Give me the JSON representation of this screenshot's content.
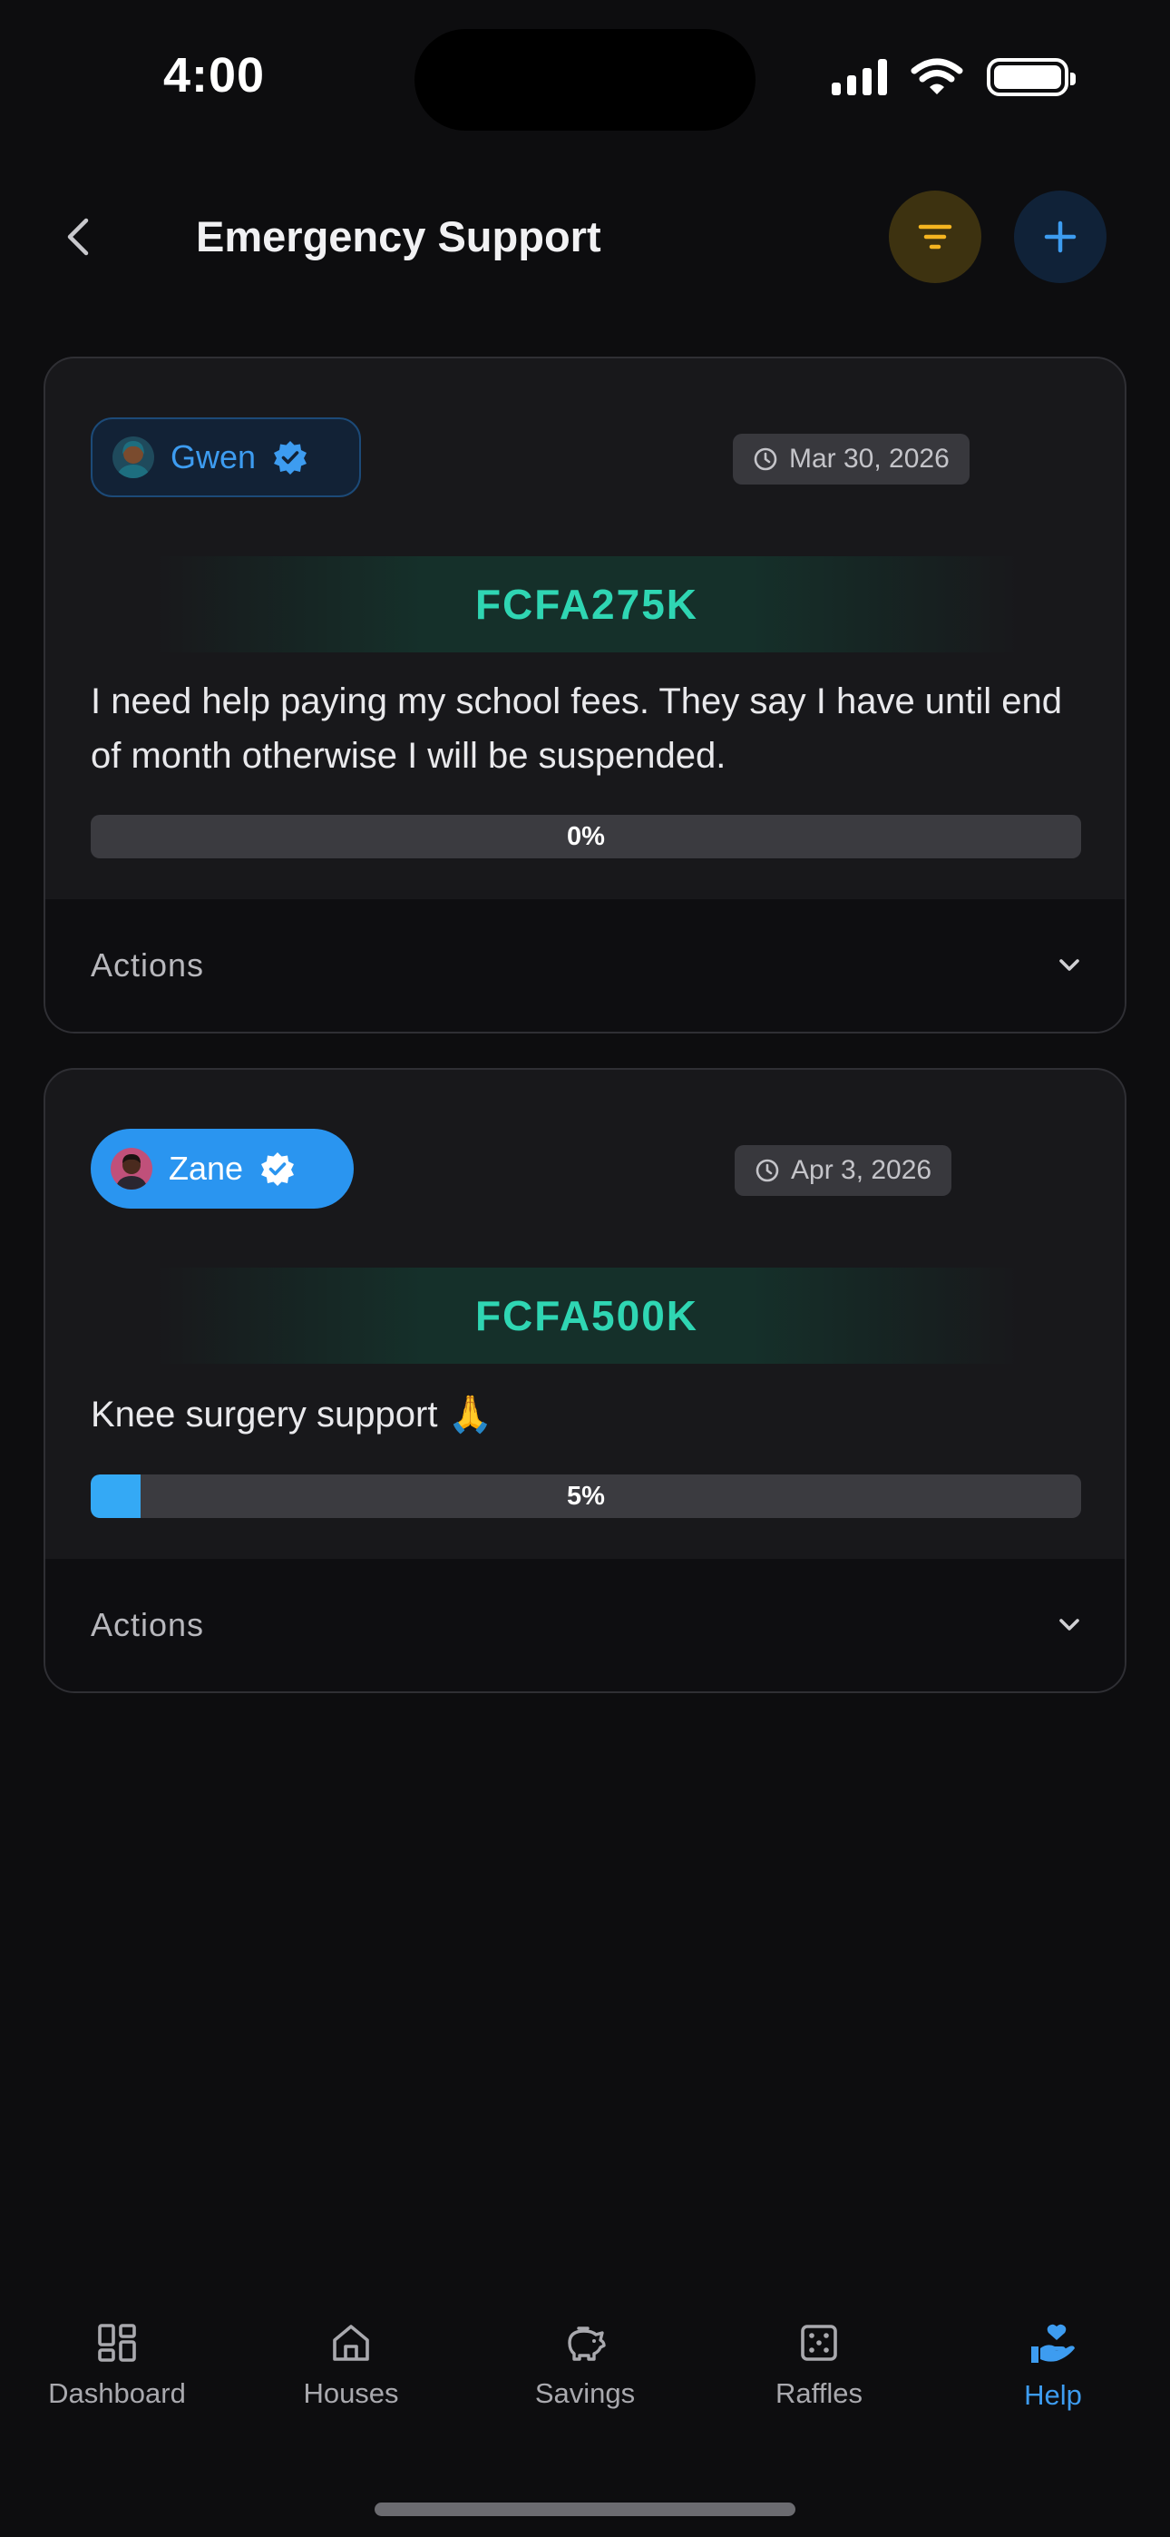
{
  "status_bar": {
    "time": "4:00"
  },
  "header": {
    "title": "Emergency Support"
  },
  "requests": [
    {
      "user": "Gwen",
      "verified": true,
      "date": "Mar 30, 2026",
      "amount": "FCFA275K",
      "description": "I need help paying my school fees. They say I have until end of month otherwise I will be suspended.",
      "progress": 0,
      "progress_label": "0%",
      "actions_label": "Actions"
    },
    {
      "user": "Zane",
      "verified": true,
      "date": "Apr 3, 2026",
      "amount": "FCFA500K",
      "description": "Knee surgery support 🙏",
      "progress": 5,
      "progress_label": "5%",
      "actions_label": "Actions"
    }
  ],
  "tabs": [
    {
      "label": "Dashboard",
      "icon": "dashboard-icon",
      "active": false
    },
    {
      "label": "Houses",
      "icon": "house-icon",
      "active": false
    },
    {
      "label": "Savings",
      "icon": "piggy-bank-icon",
      "active": false
    },
    {
      "label": "Raffles",
      "icon": "dice-icon",
      "active": false
    },
    {
      "label": "Help",
      "icon": "helping-hand-heart-icon",
      "active": true
    }
  ],
  "colors": {
    "background": "#0d0d0f",
    "card": "#18181b",
    "accent_blue": "#3d9cf0",
    "amount_teal": "#2fd6b3",
    "filter_yellow": "#f5b520",
    "progress_blue": "#34a9f5"
  }
}
